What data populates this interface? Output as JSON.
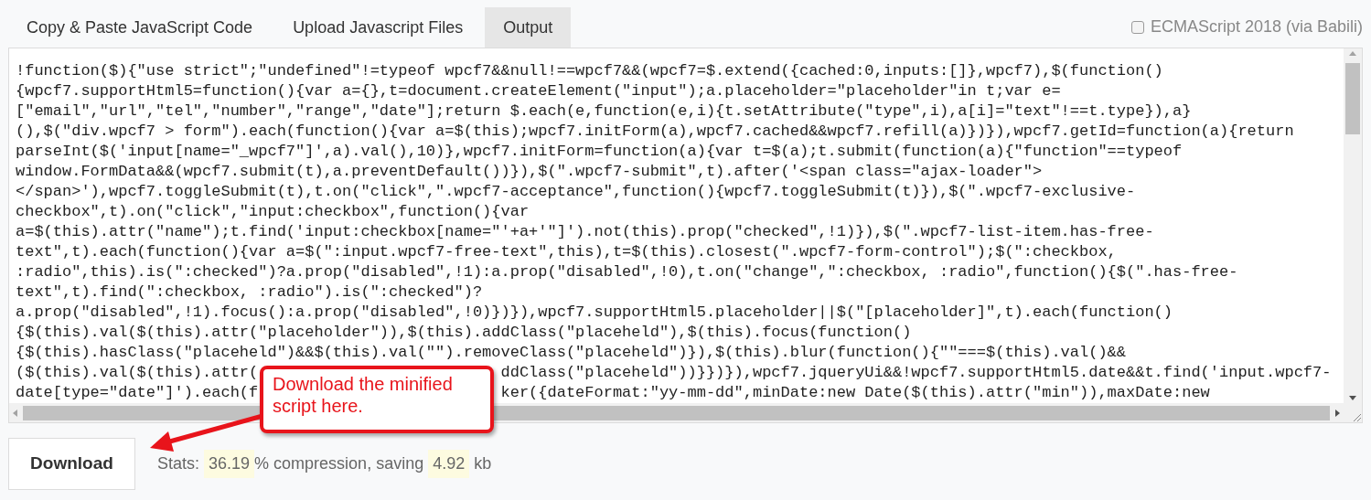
{
  "tabs": [
    {
      "label": "Copy & Paste JavaScript Code",
      "selected": false
    },
    {
      "label": "Upload Javascript Files",
      "selected": false
    },
    {
      "label": "Output",
      "selected": true
    }
  ],
  "option": {
    "label": "ECMAScript 2018 (via Babili)",
    "checked": false
  },
  "code": {
    "lines": [
      {
        "parts": [
          "!function($){\"use strict\";\"undefined\"!=typeof wpcf7&&null!==wpcf7&&(wpcf7=$.extend({cached:0,inputs:[]},wpcf7),$(function()"
        ]
      },
      {
        "parts": [
          "{wpcf7.supportHtml5=function(){var a={},t=document.createElement(\"input\");a.placeholder=\"placeholder\"in t;var e="
        ]
      },
      {
        "parts": [
          "[\"email\",\"url\",\"tel\",\"number\",\"range\",\"date\"];return $.each(e,function(e,i){t.setAttribute(\"type\",i),a[i]=\"text\"!==t.type}),a}"
        ]
      },
      {
        "parts": [
          "(),$(\"div.wpcf7 > form\").each(function(){var a=$(this);wpcf7.initForm(a),wpcf7.cached&&wpcf7.refill(a)})}),wpcf7.getId=function(a){return"
        ]
      },
      {
        "parts": [
          "parseInt($('input[name=\"_wpcf7\"]',a).val(),10)},wpcf7.initForm=function(a){var t=$(a);t.submit(function(a){\"function\"==typeof"
        ]
      },
      {
        "parts": [
          "window.FormData&&(wpcf7.submit(t),a.preventDefault())}),$(\".wpcf7-submit\",t).after('<span class=\"ajax-loader\">"
        ]
      },
      {
        "parts": [
          "</span>'),wpcf7.toggleSubmit(t),t.on(\"click\",\".wpcf7-acceptance\",function(){wpcf7.toggleSubmit(t)}),$(\".wpcf7-exclusive-"
        ]
      },
      {
        "parts": [
          "checkbox\",t).on(\"click\",\"input:checkbox\",function(){var"
        ]
      },
      {
        "parts": [
          "a=$(this).attr(\"name\");t.find('input:checkbox[name=\"'+a+'\"]').not(this).prop(\"checked\",!1)}),$(\".wpcf7-list-item.has-free-"
        ]
      },
      {
        "parts": [
          "text\",t).each(function(){var a=$(\":input.wpcf7-free-text\",this),t=$(this).closest(\".wpcf7-form-control\");$(\":checkbox,"
        ]
      },
      {
        "parts": [
          ":radio\",this).is(\":checked\")?a.prop(\"disabled\",!1):a.prop(\"disabled\",!0),t.on(\"change\",\":checkbox, :radio\",function(){$(\".has-free-"
        ]
      },
      {
        "parts": [
          "text\",t).find(\":checkbox, :radio\").is(\":checked\")?"
        ]
      },
      {
        "parts": [
          "a.prop(\"disabled\",!1).focus():a.prop(\"disabled\",!0)})}),wpcf7.supportHtml5.placeholder||$(\"[placeholder]\",t).each(function()"
        ]
      },
      {
        "parts": [
          "{$(this).val($(this).attr(\"placeholder\")),$(this).addClass(\"placeheld\"),$(this).focus(function()"
        ]
      },
      {
        "parts": [
          "{$(this).hasClass(\"placeheld\")&&$(this).val(\"\").removeClass(\"placeheld\")}),$(this).blur(function(){\"\"===$(this).val()&&"
        ]
      },
      {
        "parts": [
          "($(this).val($(this).attr(",
          "ddClass(\"placeheld\"))}})}),wpcf7.jqueryUi&&!wpcf7.supportHtml5.date&&t.find('input.wpcf7-"
        ]
      },
      {
        "parts": [
          "date[type=\"date\"]').each(f",
          "ker({dateFormat:\"yy-mm-dd\",minDate:new Date($(this).attr(\"min\")),maxDate:new"
        ]
      }
    ]
  },
  "callout": {
    "text": "Download the minified script here."
  },
  "download_button": "Download",
  "stats": {
    "label": "Stats:",
    "compression": "36.19",
    "compression_text": "% compression, saving",
    "saving": "4.92",
    "unit": "kb"
  }
}
